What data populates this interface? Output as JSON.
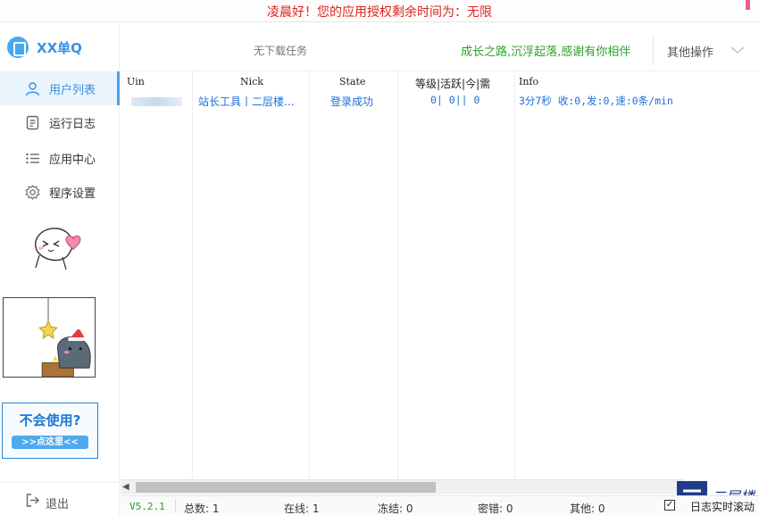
{
  "banner": {
    "text": "凌晨好！您的应用授权剩余时间为：无限"
  },
  "app": {
    "title": "XX单Q"
  },
  "sidebar": {
    "items": [
      {
        "label": "用户列表",
        "icon": "user-icon",
        "active": true
      },
      {
        "label": "运行日志",
        "icon": "log-icon",
        "active": false
      },
      {
        "label": "应用中心",
        "icon": "list-icon",
        "active": false
      },
      {
        "label": "程序设置",
        "icon": "gear-icon",
        "active": false
      }
    ],
    "help": {
      "title": "不会使用?",
      "button": ">>点这里<<"
    },
    "logout": "退出"
  },
  "header": {
    "task_status": "无下载任务",
    "slogan": "成长之路,沉浮起落,感谢有你相伴",
    "more": "其他操作"
  },
  "table": {
    "columns": [
      "Uin",
      "Nick",
      "State",
      "等级|活跃|今|需",
      "Info"
    ],
    "rows": [
      {
        "uin": "",
        "nick": "站长工具丨二层楼...",
        "state": "登录成功",
        "level": "0|   0||  0",
        "info": "3分7秒 收:0,发:0,速:0条/min"
      }
    ]
  },
  "status": {
    "version": "V5.2.1",
    "total": "总数: 1",
    "online": "在线: 1",
    "frozen": "冻结: 0",
    "pwd_error": "密错: 0",
    "other": "其他: 0",
    "autoscroll_label": "日志实时滚动",
    "autoscroll_checked": "✓"
  },
  "watermark": {
    "text": "二层楼"
  },
  "colors": {
    "accent": "#3c8fe6",
    "banner": "#e0231c",
    "slogan": "#2aa12a",
    "version": "#22a22a"
  }
}
